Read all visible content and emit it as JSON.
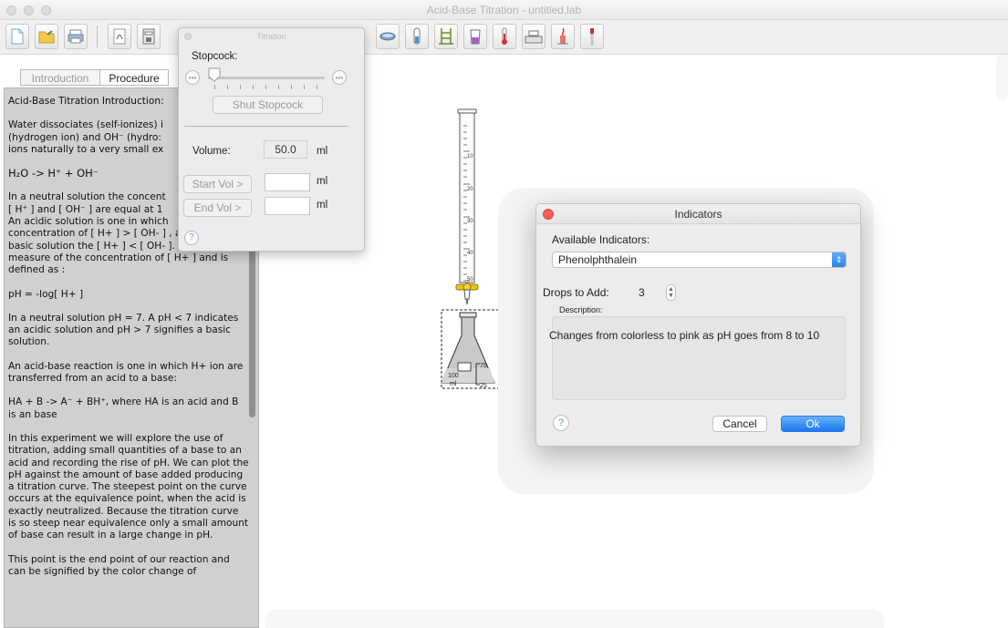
{
  "window": {
    "title": "Acid-Base Titration - untitled.lab"
  },
  "toolbar": {
    "icons": [
      "new-document",
      "open-folder",
      "print",
      "separator",
      "indicator-tool",
      "calculator",
      "tool",
      "tool",
      "tool",
      "tool",
      "tool",
      "tool",
      "dish",
      "test-tube",
      "stand",
      "beaker",
      "thermometer",
      "balance",
      "burner",
      "pipette"
    ]
  },
  "tabs": [
    {
      "label": "Introduction",
      "active": false
    },
    {
      "label": "Procedure",
      "active": true
    }
  ],
  "intro": {
    "heading": "Acid-Base Titration Introduction:",
    "p1_line1": "Water dissociates (self-ionizes) i",
    "p1_line2": "(hydrogen ion)  and OH⁻  (hydro:",
    "p1_line3": "ions naturally to a  very small ex",
    "eq1": "H₂O  -> H⁺  +  OH⁻",
    "p2_line1": "In a neutral solution  the concent",
    "p2_line2": "[ H⁺ ] and [ OH⁻ ]  are equal at 1",
    "p2_line3": "An acidic solution is one in which",
    "p2_line4": "concentration of  [ H+ ] >  [ OH- ] , and in an",
    "p2_line5": "basic solution the [ H+ ]  <  [ OH- ].  pH is a",
    "p2_line6": "measure of the concentration of [ H+ ] and is",
    "p2_line7": "defined as :",
    "eq2": "pH = -log[ H+  ]",
    "p3": "In a neutral solution pH = 7.  A  pH < 7 indicates an acidic solution and pH > 7 signifies a basic solution.",
    "p4": "An acid-base reaction is one in which  H+ ion are transferred from an acid to a base:",
    "eq3": "HA  + B  ->  A⁻  + BH⁺,    where HA is an acid and B is an base",
    "p5": "In this experiment we will explore the use of titration, adding small quantities of a base to an acid and recording the rise of  pH. We can plot the pH against the amount of base added producing a titration curve. The steepest point on the curve occurs at the equivalence point, when the acid is exactly neutralized. Because the titration curve is so steep near equivalence only a small amount of  base can result in a large change in pH.",
    "p6": "This point is the end point of our reaction and can be signified by the color change of"
  },
  "titration": {
    "title": "Titration",
    "stopcock_label": "Stopcock:",
    "stopcock_level": 0,
    "shut_button": "Shut Stopcock",
    "volume_label": "Volume:",
    "volume_value": "50.0",
    "unit": "ml",
    "start_vol_button": "Start Vol >",
    "end_vol_button": "End Vol >",
    "start_vol_value": "",
    "end_vol_value": "",
    "help": "?"
  },
  "burette": {
    "marks": [
      "10",
      "20",
      "30",
      "40",
      "50"
    ]
  },
  "flask": {
    "marks": [
      "75",
      "25"
    ],
    "label_top": "100",
    "label_bottom": "ml"
  },
  "indicators_dialog": {
    "title": "Indicators",
    "available_label": "Available Indicators:",
    "selected_indicator": "Phenolphthalein",
    "drops_label": "Drops to Add:",
    "drops_value": "3",
    "description_label": "Description:",
    "description_text": "Changes from colorless to pink as pH goes from 8 to 10",
    "help": "?",
    "cancel_button": "Cancel",
    "ok_button": "Ok"
  }
}
